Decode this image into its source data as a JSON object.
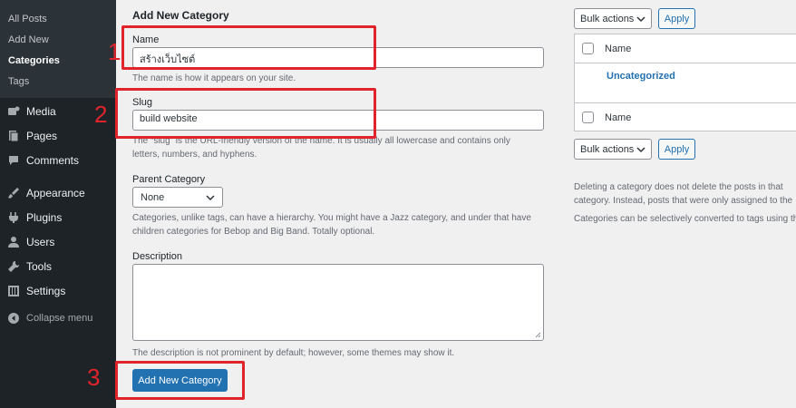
{
  "sidebar": {
    "submenu": [
      {
        "label": "All Posts"
      },
      {
        "label": "Add New"
      },
      {
        "label": "Categories"
      },
      {
        "label": "Tags"
      }
    ],
    "menu": [
      {
        "label": "Media",
        "icon": "media-icon"
      },
      {
        "label": "Pages",
        "icon": "pages-icon"
      },
      {
        "label": "Comments",
        "icon": "comments-icon"
      },
      {
        "label": "Appearance",
        "icon": "appearance-icon"
      },
      {
        "label": "Plugins",
        "icon": "plugins-icon"
      },
      {
        "label": "Users",
        "icon": "users-icon"
      },
      {
        "label": "Tools",
        "icon": "tools-icon"
      },
      {
        "label": "Settings",
        "icon": "settings-icon"
      },
      {
        "label": "Collapse menu",
        "icon": "collapse-icon"
      }
    ]
  },
  "form": {
    "title": "Add New Category",
    "name_label": "Name",
    "name_value": "สร้างเว็บไซต์",
    "name_help": "The name is how it appears on your site.",
    "slug_label": "Slug",
    "slug_value": "build website",
    "slug_help": "The “slug” is the URL-friendly version of the name. It is usually all lowercase and contains only letters, numbers, and hyphens.",
    "parent_label": "Parent Category",
    "parent_value": "None",
    "parent_help": "Categories, unlike tags, can have a hierarchy. You might have a Jazz category, and under that have children categories for Bebop and Big Band. Totally optional.",
    "description_label": "Description",
    "description_help": "The description is not prominent by default; however, some themes may show it.",
    "submit_label": "Add New Category"
  },
  "annotations": [
    "1",
    "2",
    "3"
  ],
  "list": {
    "bulk_label": "Bulk actions",
    "apply_label": "Apply",
    "column_name": "Name",
    "rows": [
      "Uncategorized"
    ],
    "note1": "Deleting a category does not delete the posts in that category. Instead, posts that were only assigned to the deleted category are set to the default category Uncategorized. The default category cannot be deleted.",
    "note2": "Categories can be selectively converted to tags using the category to tag converter."
  },
  "colors": {
    "sidebar_bg": "#1d2327",
    "accent": "#2271b1",
    "annotation_red": "#e1242c"
  }
}
